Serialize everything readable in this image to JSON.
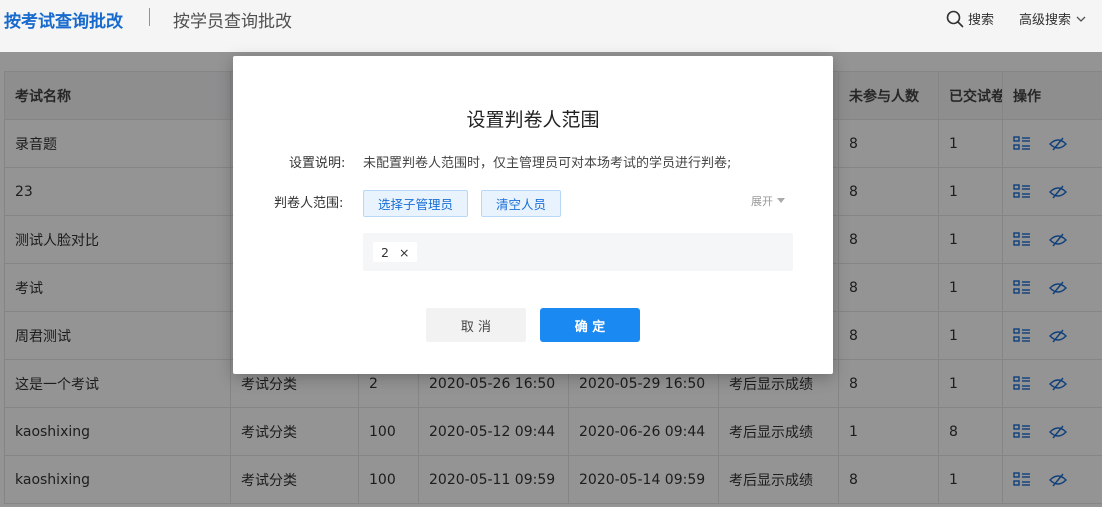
{
  "header": {
    "tab_active": "按考试查询批改",
    "tab_inactive": "按学员查询批改",
    "search_label": "搜索",
    "advanced_search_label": "高级搜索"
  },
  "table": {
    "columns": [
      "考试名称",
      "",
      "",
      "",
      "",
      "",
      "未参与人数",
      "已交试卷",
      "操作"
    ],
    "rows": [
      [
        "录音题",
        "",
        "",
        "",
        "",
        "",
        "8",
        "1"
      ],
      [
        "23",
        "",
        "",
        "",
        "",
        "",
        "8",
        "1"
      ],
      [
        "测试人脸对比",
        "",
        "",
        "",
        "",
        "",
        "8",
        "1"
      ],
      [
        "考试",
        "",
        "",
        "",
        "",
        "",
        "8",
        "1"
      ],
      [
        "周君测试",
        "",
        "",
        "",
        "",
        "",
        "8",
        "1"
      ],
      [
        "这是一个考试",
        "考试分类",
        "2",
        "2020-05-26 16:50",
        "2020-05-29 16:50",
        "考后显示成绩",
        "8",
        "1"
      ],
      [
        "kaoshixing",
        "考试分类",
        "100",
        "2020-05-12 09:44",
        "2020-06-26 09:44",
        "考后显示成绩",
        "1",
        "8"
      ],
      [
        "kaoshixing",
        "考试分类",
        "100",
        "2020-05-11 09:59",
        "2020-05-14 09:59",
        "考后显示成绩",
        "8",
        "1"
      ]
    ]
  },
  "modal": {
    "title": "设置判卷人范围",
    "desc_label": "设置说明:",
    "desc_text": "未配置判卷人范围时，仅主管理员可对本场考试的学员进行判卷;",
    "scope_label": "判卷人范围:",
    "select_admin_btn": "选择子管理员",
    "clear_btn": "清空人员",
    "expand_label": "展开",
    "tag_value": "2",
    "tag_close": "×",
    "cancel_btn": "取 消",
    "confirm_btn": "确 定"
  },
  "colors": {
    "accent": "#1a6fd6",
    "confirm_bg": "#1a89f2"
  }
}
